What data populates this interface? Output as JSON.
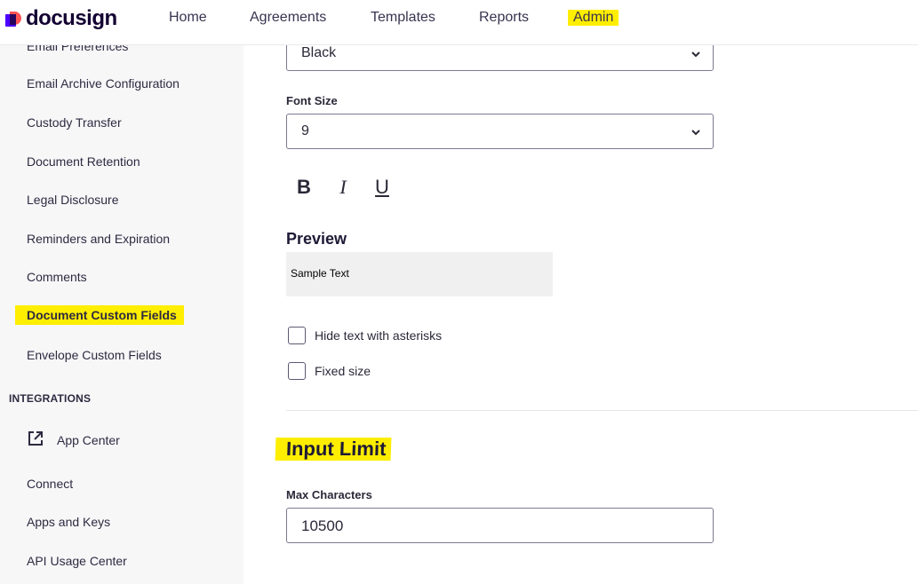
{
  "brand": {
    "name": "docusign"
  },
  "nav": {
    "home": "Home",
    "agreements": "Agreements",
    "templates": "Templates",
    "reports": "Reports",
    "admin": "Admin"
  },
  "sidebar": {
    "items": [
      {
        "label": "Email Preferences"
      },
      {
        "label": "Email Archive Configuration"
      },
      {
        "label": "Custody Transfer"
      },
      {
        "label": "Document Retention"
      },
      {
        "label": "Legal Disclosure"
      },
      {
        "label": "Reminders and Expiration"
      },
      {
        "label": "Comments"
      },
      {
        "label": "Document Custom Fields",
        "active": true
      },
      {
        "label": "Envelope Custom Fields"
      }
    ],
    "integrations_heading": "INTEGRATIONS",
    "integrations": [
      {
        "label": "App Center",
        "icon": "external-link-icon"
      },
      {
        "label": "Connect"
      },
      {
        "label": "Apps and Keys"
      },
      {
        "label": "API Usage Center"
      }
    ]
  },
  "form": {
    "color_select": {
      "value": "Black"
    },
    "font_size": {
      "label": "Font Size",
      "value": "9"
    },
    "format": {
      "bold": "B",
      "italic": "I",
      "underline": "U"
    },
    "preview": {
      "title": "Preview",
      "sample": "Sample Text"
    },
    "checkboxes": [
      {
        "label": "Hide text with asterisks",
        "checked": false
      },
      {
        "label": "Fixed size",
        "checked": false
      }
    ],
    "input_limit": {
      "title": "Input Limit",
      "max_characters_label": "Max Characters",
      "max_characters_value": "10500"
    }
  },
  "colors": {
    "highlight": "#ffee00",
    "brand_purple": "#4c00ff",
    "brand_coral": "#ff5252"
  }
}
